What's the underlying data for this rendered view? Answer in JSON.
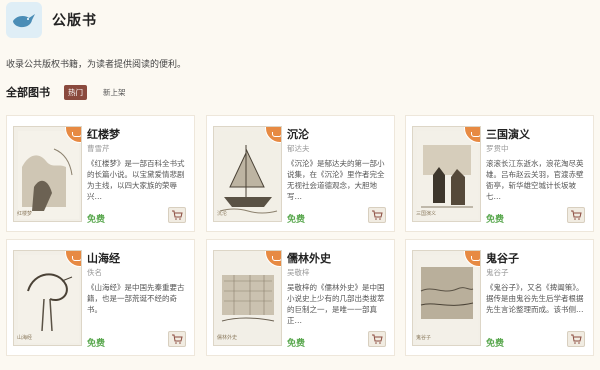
{
  "header": {
    "logo_icon": "bird-icon",
    "title": "公版书"
  },
  "description": "收录公共版权书籍，为读者提供阅读的便利。",
  "section": {
    "title": "全部图书",
    "filters": [
      {
        "label": "热门",
        "active": true
      },
      {
        "label": "新上架",
        "active": false
      }
    ]
  },
  "colors": {
    "accent": "#8a4a3e",
    "badge": "#e78a43",
    "free": "#5aa84f",
    "background": "#fcf9f2"
  },
  "books": [
    {
      "title": "红楼梦",
      "author": "曹雪芹",
      "description": "《红楼梦》是一部百科全书式的长篇小说。以宝黛爱情悲剧为主线，以四大家族的荣辱兴…",
      "price": "免费",
      "cover_text": "红楼梦"
    },
    {
      "title": "沉沦",
      "author": "郁达夫",
      "description": "《沉沦》是郁达夫的第一部小说集，在《沉沦》里作者完全无视社会道德观念，大胆地写…",
      "price": "免费",
      "cover_text": "沉沦"
    },
    {
      "title": "三国演义",
      "author": "罗贯中",
      "description": "滚滚长江东逝水，浪花淘尽英雄。吕布赵云关羽，官渡赤壁衙亭，斩华雄空城计长坂坡七…",
      "price": "免费",
      "cover_text": "三国演义"
    },
    {
      "title": "山海经",
      "author": "佚名",
      "description": "《山海经》是中国先秦重要古籍，也是一部荒诞不经的奇书。",
      "price": "免费",
      "cover_text": "山海经"
    },
    {
      "title": "儒林外史",
      "author": "吴敬梓",
      "description": "吴敬梓的《儒林外史》是中国小说史上少有的几部出类拔萃的巨制之一，是唯一一部真正…",
      "price": "免费",
      "cover_text": "儒林外史"
    },
    {
      "title": "鬼谷子",
      "author": "鬼谷子",
      "description": "《鬼谷子》，又名《捭阖策》。据传是由鬼谷先生后学者根据先生言论整理而成。该书侧…",
      "price": "免费",
      "cover_text": "鬼谷子"
    }
  ]
}
